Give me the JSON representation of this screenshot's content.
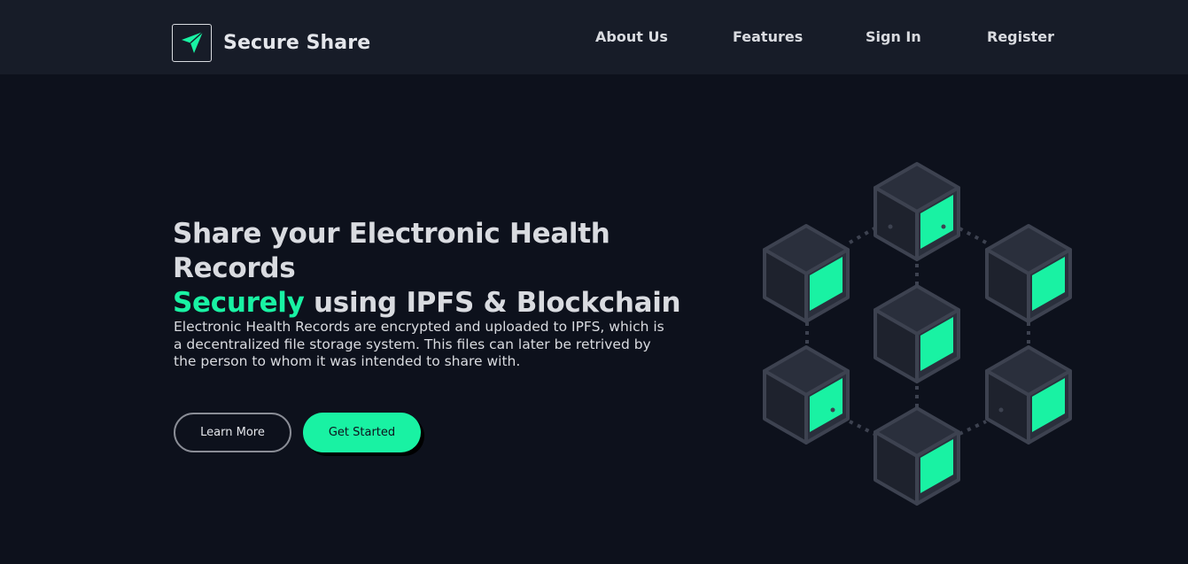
{
  "brand": {
    "name": "Secure Share",
    "logo_icon": "send-arrow-icon"
  },
  "nav": {
    "items": [
      {
        "label": "About Us"
      },
      {
        "label": "Features"
      },
      {
        "label": "Sign In"
      },
      {
        "label": "Register"
      }
    ]
  },
  "hero": {
    "title_line1": "Share your Electronic Health Records",
    "title_accent": "Securely",
    "title_rest": " using IPFS & Blockchain",
    "description": "Electronic Health Records are encrypted and uploaded to IPFS, which is a decentralized file storage system. This files can later be retrived by the person to whom it was intended to share with.",
    "learn_more_label": "Learn More",
    "get_started_label": "Get Started"
  },
  "colors": {
    "background": "#0d111c",
    "navbar": "#171c28",
    "accent": "#19f2a3",
    "text": "#d9dbe0"
  },
  "illustration": {
    "icon": "blockchain-cubes-icon",
    "cube_count": 7
  }
}
